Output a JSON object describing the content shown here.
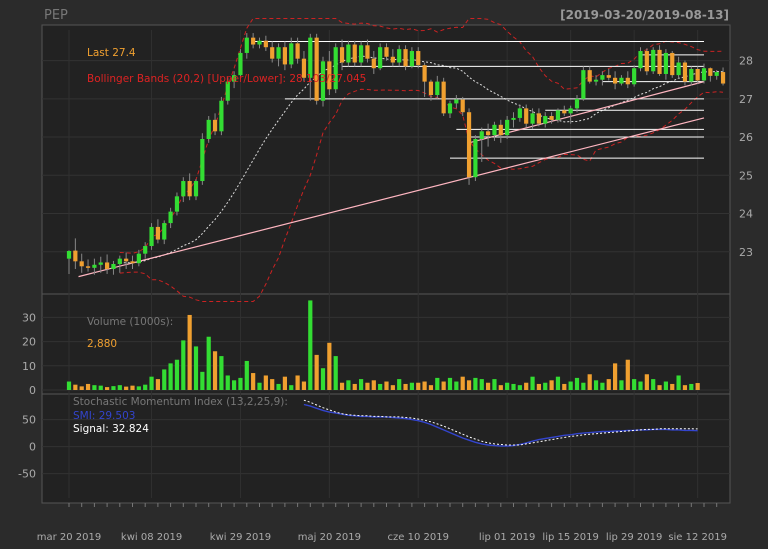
{
  "header": {
    "symbol": "PEP",
    "date_range": "[2019-03-20/2019-08-13]"
  },
  "colors": {
    "background": "#2b2b2b",
    "panel": "#222222",
    "frame": "#555555",
    "up": "#33dd33",
    "down": "#f0a030",
    "bb_band": "#cc2222",
    "bb_mid": "#dddddd",
    "trendline": "#ffb6c1",
    "level": "#ffffff",
    "smi": "#3344cc",
    "signal": "#ffffff",
    "label_last": "#f0a030",
    "label_bb": "#dd2222",
    "label_grey": "#777777",
    "tick_text": "#aaaaaa"
  },
  "chart_data": [
    {
      "type": "candlestick",
      "panel": "price",
      "legend": {
        "last": "Last 27.4",
        "bbands": "Bollinger Bands (20,2) [Upper/Lower]: 28.103/27.045"
      },
      "ylim": [
        22,
        28.8
      ],
      "y_ticks": [
        23,
        24,
        25,
        26,
        27,
        28
      ],
      "x_labels": [
        "mar 20 2019",
        "kwi 08 2019",
        "kwi 29 2019",
        "maj 20 2019",
        "cze 10 2019",
        "lip 01 2019",
        "lip 15 2019",
        "lip 29 2019",
        "sie 12 2019"
      ],
      "x_label_index": [
        0,
        13,
        27,
        41,
        55,
        69,
        79,
        89,
        99
      ],
      "candles": [
        {
          "o": 22.82,
          "h": 23.04,
          "l": 22.42,
          "c": 23.02
        },
        {
          "o": 23.03,
          "h": 23.35,
          "l": 22.55,
          "c": 22.75
        },
        {
          "o": 22.75,
          "h": 22.95,
          "l": 22.45,
          "c": 22.62
        },
        {
          "o": 22.62,
          "h": 22.8,
          "l": 22.48,
          "c": 22.58
        },
        {
          "o": 22.58,
          "h": 22.82,
          "l": 22.4,
          "c": 22.66
        },
        {
          "o": 22.66,
          "h": 22.87,
          "l": 22.45,
          "c": 22.72
        },
        {
          "o": 22.72,
          "h": 22.93,
          "l": 22.42,
          "c": 22.55
        },
        {
          "o": 22.55,
          "h": 22.76,
          "l": 22.4,
          "c": 22.68
        },
        {
          "o": 22.68,
          "h": 22.9,
          "l": 22.45,
          "c": 22.82
        },
        {
          "o": 22.82,
          "h": 22.98,
          "l": 22.55,
          "c": 22.75
        },
        {
          "o": 22.75,
          "h": 22.9,
          "l": 22.55,
          "c": 22.7
        },
        {
          "o": 22.7,
          "h": 23.05,
          "l": 22.62,
          "c": 22.95
        },
        {
          "o": 22.95,
          "h": 23.25,
          "l": 22.82,
          "c": 23.15
        },
        {
          "o": 23.15,
          "h": 23.75,
          "l": 23.05,
          "c": 23.65
        },
        {
          "o": 23.65,
          "h": 23.85,
          "l": 23.22,
          "c": 23.32
        },
        {
          "o": 23.32,
          "h": 23.82,
          "l": 23.2,
          "c": 23.75
        },
        {
          "o": 23.75,
          "h": 24.15,
          "l": 23.62,
          "c": 24.05
        },
        {
          "o": 24.05,
          "h": 24.55,
          "l": 23.95,
          "c": 24.45
        },
        {
          "o": 24.45,
          "h": 24.95,
          "l": 24.3,
          "c": 24.85
        },
        {
          "o": 24.85,
          "h": 25.05,
          "l": 24.35,
          "c": 24.45
        },
        {
          "o": 24.45,
          "h": 24.9,
          "l": 24.35,
          "c": 24.85
        },
        {
          "o": 24.85,
          "h": 26.1,
          "l": 24.75,
          "c": 25.95
        },
        {
          "o": 25.95,
          "h": 26.55,
          "l": 25.85,
          "c": 26.45
        },
        {
          "o": 26.45,
          "h": 26.62,
          "l": 26.05,
          "c": 26.15
        },
        {
          "o": 26.15,
          "h": 27.05,
          "l": 26.05,
          "c": 26.95
        },
        {
          "o": 26.95,
          "h": 27.55,
          "l": 26.85,
          "c": 27.45
        },
        {
          "o": 27.45,
          "h": 27.72,
          "l": 27.28,
          "c": 27.62
        },
        {
          "o": 27.62,
          "h": 28.3,
          "l": 27.52,
          "c": 28.2
        },
        {
          "o": 28.2,
          "h": 28.72,
          "l": 28.05,
          "c": 28.6
        },
        {
          "o": 28.6,
          "h": 28.72,
          "l": 28.32,
          "c": 28.42
        },
        {
          "o": 28.42,
          "h": 28.6,
          "l": 28.32,
          "c": 28.52
        },
        {
          "o": 28.52,
          "h": 28.65,
          "l": 28.25,
          "c": 28.35
        },
        {
          "o": 28.35,
          "h": 28.5,
          "l": 27.95,
          "c": 28.05
        },
        {
          "o": 28.05,
          "h": 28.45,
          "l": 27.85,
          "c": 28.35
        },
        {
          "o": 28.35,
          "h": 28.5,
          "l": 27.75,
          "c": 27.9
        },
        {
          "o": 27.9,
          "h": 28.6,
          "l": 27.8,
          "c": 28.45
        },
        {
          "o": 28.45,
          "h": 28.6,
          "l": 27.92,
          "c": 28.05
        },
        {
          "o": 28.05,
          "h": 28.25,
          "l": 27.45,
          "c": 27.55
        },
        {
          "o": 27.55,
          "h": 28.7,
          "l": 26.95,
          "c": 28.6
        },
        {
          "o": 28.6,
          "h": 28.7,
          "l": 26.85,
          "c": 26.95
        },
        {
          "o": 26.95,
          "h": 28.1,
          "l": 26.8,
          "c": 27.98
        },
        {
          "o": 27.98,
          "h": 28.25,
          "l": 27.1,
          "c": 27.25
        },
        {
          "o": 27.25,
          "h": 28.45,
          "l": 27.15,
          "c": 28.35
        },
        {
          "o": 28.35,
          "h": 28.55,
          "l": 27.75,
          "c": 27.95
        },
        {
          "o": 27.95,
          "h": 28.52,
          "l": 27.85,
          "c": 28.42
        },
        {
          "o": 28.42,
          "h": 28.52,
          "l": 27.85,
          "c": 27.95
        },
        {
          "o": 27.95,
          "h": 28.5,
          "l": 27.85,
          "c": 28.4
        },
        {
          "o": 28.4,
          "h": 28.55,
          "l": 27.95,
          "c": 28.05
        },
        {
          "o": 28.05,
          "h": 28.25,
          "l": 27.65,
          "c": 27.8
        },
        {
          "o": 27.8,
          "h": 28.45,
          "l": 27.75,
          "c": 28.35
        },
        {
          "o": 28.35,
          "h": 28.45,
          "l": 28.0,
          "c": 28.1
        },
        {
          "o": 28.1,
          "h": 28.3,
          "l": 27.85,
          "c": 27.95
        },
        {
          "o": 27.95,
          "h": 28.4,
          "l": 27.85,
          "c": 28.3
        },
        {
          "o": 28.3,
          "h": 28.4,
          "l": 27.75,
          "c": 27.85
        },
        {
          "o": 27.85,
          "h": 28.35,
          "l": 27.8,
          "c": 28.25
        },
        {
          "o": 28.25,
          "h": 28.35,
          "l": 27.8,
          "c": 27.88
        },
        {
          "o": 27.88,
          "h": 27.95,
          "l": 27.05,
          "c": 27.45
        },
        {
          "o": 27.45,
          "h": 27.5,
          "l": 26.95,
          "c": 27.1
        },
        {
          "o": 27.1,
          "h": 27.6,
          "l": 27.0,
          "c": 27.45
        },
        {
          "o": 27.45,
          "h": 27.55,
          "l": 26.55,
          "c": 26.62
        },
        {
          "o": 26.62,
          "h": 26.95,
          "l": 26.5,
          "c": 26.88
        },
        {
          "o": 26.88,
          "h": 27.1,
          "l": 26.75,
          "c": 26.98
        },
        {
          "o": 26.98,
          "h": 27.05,
          "l": 26.55,
          "c": 26.65
        },
        {
          "o": 26.65,
          "h": 26.75,
          "l": 24.75,
          "c": 24.95
        },
        {
          "o": 24.95,
          "h": 26.05,
          "l": 24.85,
          "c": 25.95
        },
        {
          "o": 25.95,
          "h": 26.25,
          "l": 25.35,
          "c": 26.15
        },
        {
          "o": 26.15,
          "h": 26.35,
          "l": 25.75,
          "c": 26.05
        },
        {
          "o": 26.05,
          "h": 26.4,
          "l": 25.9,
          "c": 26.32
        },
        {
          "o": 26.32,
          "h": 26.45,
          "l": 25.85,
          "c": 26.05
        },
        {
          "o": 26.05,
          "h": 26.55,
          "l": 25.95,
          "c": 26.45
        },
        {
          "o": 26.45,
          "h": 26.65,
          "l": 26.25,
          "c": 26.5
        },
        {
          "o": 26.5,
          "h": 26.85,
          "l": 26.4,
          "c": 26.75
        },
        {
          "o": 26.75,
          "h": 26.85,
          "l": 26.25,
          "c": 26.35
        },
        {
          "o": 26.35,
          "h": 26.75,
          "l": 26.22,
          "c": 26.62
        },
        {
          "o": 26.62,
          "h": 26.75,
          "l": 26.28,
          "c": 26.35
        },
        {
          "o": 26.35,
          "h": 26.65,
          "l": 26.25,
          "c": 26.55
        },
        {
          "o": 26.55,
          "h": 26.65,
          "l": 26.35,
          "c": 26.45
        },
        {
          "o": 26.45,
          "h": 26.75,
          "l": 26.38,
          "c": 26.7
        },
        {
          "o": 26.7,
          "h": 26.82,
          "l": 26.55,
          "c": 26.62
        },
        {
          "o": 26.62,
          "h": 26.82,
          "l": 26.35,
          "c": 26.75
        },
        {
          "o": 26.75,
          "h": 27.1,
          "l": 26.65,
          "c": 27.0
        },
        {
          "o": 27.0,
          "h": 27.85,
          "l": 26.95,
          "c": 27.75
        },
        {
          "o": 27.75,
          "h": 27.85,
          "l": 27.4,
          "c": 27.45
        },
        {
          "o": 27.45,
          "h": 27.62,
          "l": 27.35,
          "c": 27.5
        },
        {
          "o": 27.5,
          "h": 27.72,
          "l": 27.35,
          "c": 27.62
        },
        {
          "o": 27.62,
          "h": 27.78,
          "l": 27.48,
          "c": 27.55
        },
        {
          "o": 27.55,
          "h": 27.72,
          "l": 27.25,
          "c": 27.4
        },
        {
          "o": 27.4,
          "h": 27.62,
          "l": 27.35,
          "c": 27.55
        },
        {
          "o": 27.55,
          "h": 27.72,
          "l": 27.28,
          "c": 27.38
        },
        {
          "o": 27.38,
          "h": 27.88,
          "l": 27.32,
          "c": 27.8
        },
        {
          "o": 27.8,
          "h": 28.35,
          "l": 27.72,
          "c": 28.25
        },
        {
          "o": 28.25,
          "h": 28.32,
          "l": 27.62,
          "c": 27.72
        },
        {
          "o": 27.72,
          "h": 28.35,
          "l": 27.65,
          "c": 28.28
        },
        {
          "o": 28.28,
          "h": 28.4,
          "l": 27.6,
          "c": 27.65
        },
        {
          "o": 27.65,
          "h": 28.3,
          "l": 27.5,
          "c": 28.2
        },
        {
          "o": 28.2,
          "h": 28.25,
          "l": 27.55,
          "c": 27.62
        },
        {
          "o": 27.62,
          "h": 28.1,
          "l": 27.52,
          "c": 27.95
        },
        {
          "o": 27.95,
          "h": 28.0,
          "l": 27.35,
          "c": 27.45
        },
        {
          "o": 27.45,
          "h": 27.85,
          "l": 27.35,
          "c": 27.78
        },
        {
          "o": 27.78,
          "h": 27.85,
          "l": 27.4,
          "c": 27.48
        },
        {
          "o": 27.48,
          "h": 27.92,
          "l": 27.4,
          "c": 27.8
        },
        {
          "o": 27.8,
          "h": 27.82,
          "l": 27.45,
          "c": 27.6
        },
        {
          "o": 27.6,
          "h": 27.75,
          "l": 27.5,
          "c": 27.7
        },
        {
          "o": 27.7,
          "h": 27.82,
          "l": 27.35,
          "c": 27.4
        }
      ],
      "levels": [
        {
          "y": 28.5,
          "from": 29,
          "to": 100
        },
        {
          "y": 27.85,
          "from": 43,
          "to": 100
        },
        {
          "y": 27.0,
          "from": 34,
          "to": 100
        },
        {
          "y": 26.2,
          "from": 61,
          "to": 100
        },
        {
          "y": 26.0,
          "from": 63,
          "to": 100
        },
        {
          "y": 25.45,
          "from": 60,
          "to": 100
        },
        {
          "y": 26.7,
          "from": 75,
          "to": 100
        },
        {
          "y": 27.45,
          "from": 84,
          "to": 100
        },
        {
          "y": 28.15,
          "from": 90,
          "to": 100
        }
      ],
      "trendlines": [
        {
          "x1": 1.5,
          "y1": 22.35,
          "x2": 100,
          "y2": 26.5
        },
        {
          "x1": 63,
          "y1": 25.85,
          "x2": 100,
          "y2": 27.45
        }
      ]
    },
    {
      "type": "bar",
      "panel": "volume",
      "legend": {
        "label": "Volume (1000s):",
        "last": "2,880"
      },
      "ylim": [
        0,
        38
      ],
      "y_ticks": [
        0,
        10,
        20,
        30
      ],
      "values": [
        3.5,
        2.2,
        1.5,
        2.5,
        2.0,
        1.8,
        1.2,
        1.6,
        2.0,
        1.4,
        1.8,
        1.5,
        2.2,
        5.5,
        4.5,
        8.5,
        11.0,
        12.5,
        20.5,
        31.0,
        18.0,
        7.5,
        22.0,
        16.0,
        14.0,
        6.0,
        4.0,
        5.0,
        12.0,
        7.0,
        3.0,
        6.0,
        4.5,
        2.5,
        5.5,
        2.0,
        6.0,
        3.5,
        37.0,
        14.5,
        9.0,
        19.5,
        14.0,
        3.0,
        4.0,
        2.5,
        4.5,
        3.0,
        4.0,
        2.5,
        3.5,
        2.0,
        4.5,
        2.5,
        3.0,
        3.0,
        3.5,
        2.0,
        5.0,
        3.5,
        5.0,
        3.5,
        5.5,
        4.0,
        5.0,
        4.5,
        3.0,
        4.5,
        2.0,
        3.0,
        2.5,
        2.0,
        3.0,
        5.5,
        2.5,
        3.0,
        4.0,
        5.5,
        2.5,
        3.5,
        5.0,
        3.0,
        6.5,
        4.0,
        3.0,
        4.5,
        11.0,
        4.0,
        12.5,
        4.5,
        3.5,
        6.5,
        4.5,
        2.0,
        3.5,
        2.5,
        6.0,
        2.0,
        2.5,
        2.88
      ]
    },
    {
      "type": "line",
      "panel": "smi",
      "legend": {
        "title": "Stochastic Momentum Index (13,2,25,9):",
        "smi": "SMI: 29.503",
        "signal": "Signal: 32.824"
      },
      "ylim": [
        -95,
        90
      ],
      "y_ticks": [
        -50,
        0,
        50
      ],
      "start_index": 37,
      "series": [
        {
          "name": "SMI",
          "values": [
            78,
            75,
            71,
            67,
            64,
            62,
            60,
            58,
            57,
            56,
            56,
            55,
            55,
            55,
            54,
            53,
            52,
            50,
            48,
            45,
            41,
            36,
            31,
            26,
            21,
            16,
            12,
            8,
            5,
            3,
            2,
            1,
            1,
            2,
            4,
            7,
            10,
            13,
            15,
            17,
            19,
            21,
            22,
            24,
            25,
            26,
            27,
            28,
            28,
            29,
            29,
            30,
            30,
            31,
            31,
            32,
            32,
            32,
            31,
            31,
            30,
            30,
            29.5
          ]
        },
        {
          "name": "Signal",
          "values": [
            86,
            82,
            77,
            72,
            68,
            64,
            61,
            59,
            58,
            57,
            57,
            56,
            56,
            55,
            55,
            55,
            54,
            53,
            51,
            49,
            46,
            42,
            38,
            33,
            28,
            23,
            18,
            14,
            10,
            7,
            5,
            4,
            3,
            3,
            3,
            5,
            7,
            9,
            11,
            13,
            15,
            17,
            19,
            20,
            22,
            23,
            24,
            25,
            26,
            27,
            28,
            29,
            30,
            31,
            32,
            32,
            33,
            33,
            33,
            33,
            33,
            33,
            32.8
          ]
        }
      ]
    }
  ]
}
